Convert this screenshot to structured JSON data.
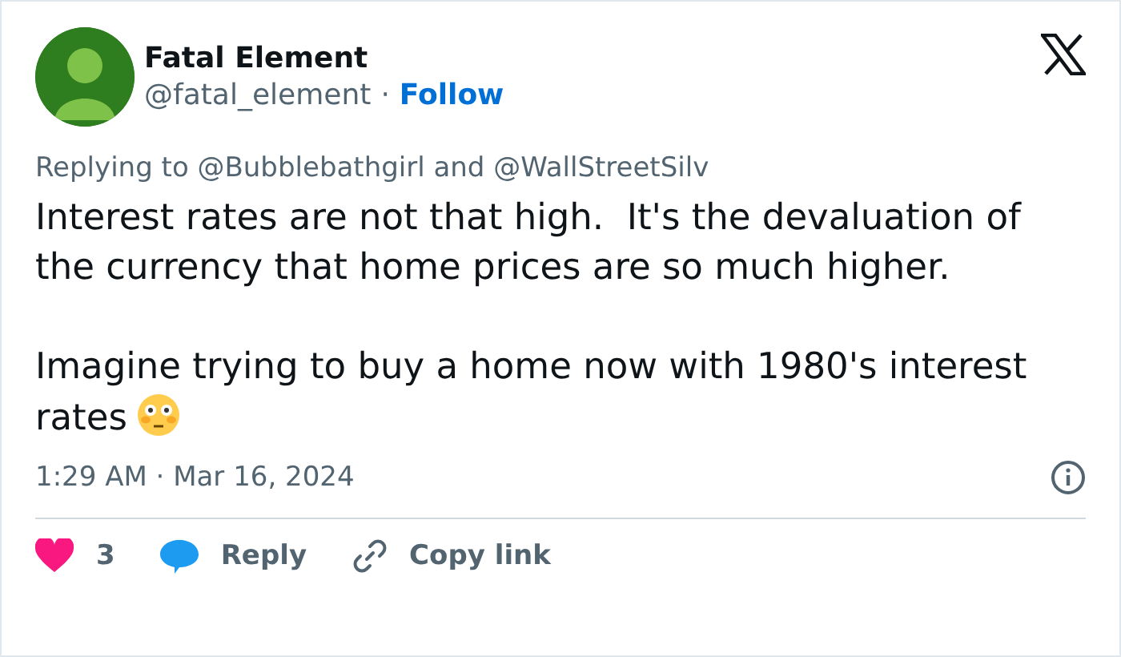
{
  "author": {
    "name": "Fatal Element",
    "handle": "@fatal_element",
    "separator": "·",
    "follow": "Follow"
  },
  "reply_context": "Replying to @Bubblebathgirl and @WallStreetSilv",
  "paragraphs": [
    "Interest rates are not that high.  It's the devaluation of the currency that home prices are so much higher.",
    "Imagine trying to buy a home now with 1980's interest rates"
  ],
  "timestamp": "1:29 AM · Mar 16, 2024",
  "actions": [
    {
      "kind": "like",
      "label": "3"
    },
    {
      "kind": "reply",
      "label": "Reply"
    },
    {
      "kind": "copy",
      "label": "Copy link"
    }
  ]
}
